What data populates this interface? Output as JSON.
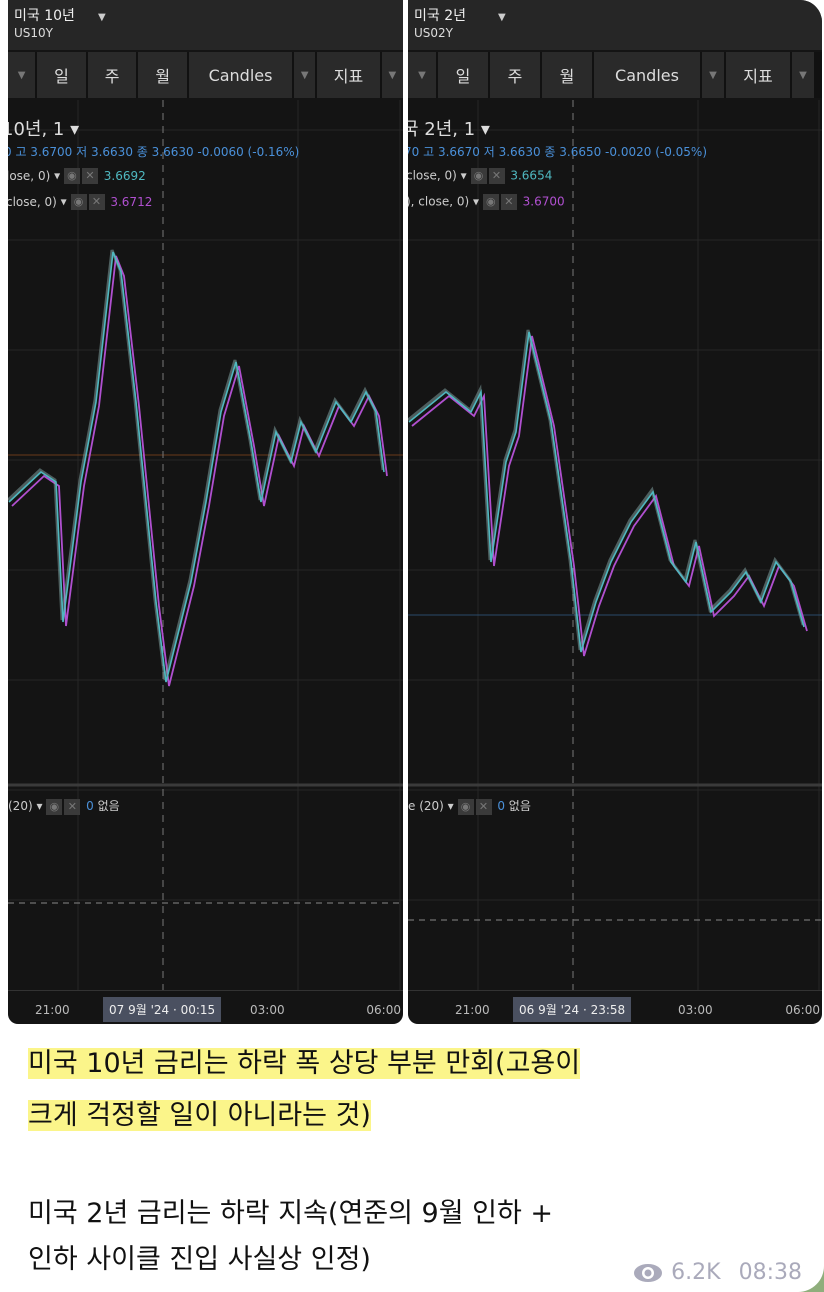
{
  "charts": [
    {
      "title": "미국 10년",
      "symbol": "US10Y",
      "toolbar": [
        "일",
        "주",
        "월",
        "Candles",
        "지표"
      ],
      "legend_title": "10년, 1",
      "ohlc": "0 고 3.6700 저 3.6630 종 3.6630  -0.0060 (-0.16%)",
      "ma1_label": "lose, 0)",
      "ma1_value": "3.6692",
      "ma2_label": "close, 0)",
      "ma2_value": "3.6712",
      "vol_label": "(20)",
      "vol_value": "0",
      "vol_none": "없음",
      "times": [
        "21:00",
        "03:00",
        "06:00"
      ],
      "cursor_time": "07 9월 '24 · 00:15"
    },
    {
      "title": "미국 2년",
      "symbol": "US02Y",
      "toolbar": [
        "일",
        "주",
        "월",
        "Candles",
        "지표"
      ],
      "legend_title": "국 2년, 1",
      "ohlc": "70 고 3.6670 저 3.6630 종 3.6650  -0.0020 (-0.05%)",
      "ma1_label": "close, 0)",
      "ma1_value": "3.6654",
      "ma2_label": "), close, 0)",
      "ma2_value": "3.6700",
      "vol_label": "e (20)",
      "vol_value": "0",
      "vol_none": "없음",
      "times": [
        "21:00",
        "03:00",
        "06:00"
      ],
      "cursor_time": "06 9월 '24 · 23:58"
    }
  ],
  "colors": {
    "ohlc": "#4a90d9",
    "ma1": "#4fb8c0",
    "ma2": "#b050d0",
    "highlight": "#fbf58a"
  },
  "message": {
    "line1": "미국 10년 금리는 하락 폭 상당 부분 만회(고용이",
    "line2": "크게 걱정할 일이 아니라는 것)",
    "line3": "미국 2년 금리는 하락 지속(연준의 9월 인하 +",
    "line4": "인하 사이클 진입 사실상 인정)",
    "views": "6.2K",
    "time": "08:38",
    "views_icon": "eye-icon"
  }
}
